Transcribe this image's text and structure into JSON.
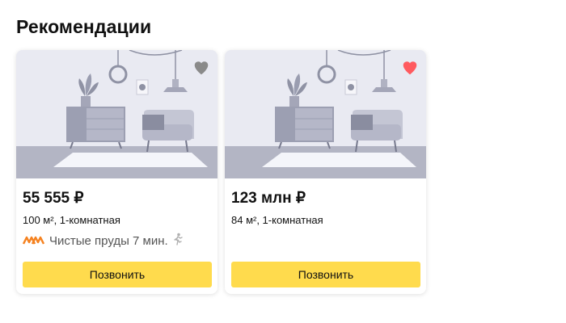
{
  "section": {
    "title": "Рекомендации"
  },
  "colors": {
    "accent_button": "#ffdb4d",
    "favorite_active": "#ff5a5f",
    "favorite_inactive": "#8a8a8a",
    "metro_line": "#f58220"
  },
  "cards": [
    {
      "price": "55 555 ₽",
      "details": "100 м², 1-комнатная",
      "metro_station": "Чистые пруды 7 мин.",
      "favorite": false,
      "icons": [
        "heart-icon",
        "metro-icon",
        "walk-icon"
      ],
      "call_label": "Позвонить"
    },
    {
      "price": "123 млн ₽",
      "details": "84 м², 1-комнатная",
      "favorite": true,
      "icons": [
        "heart-icon"
      ],
      "call_label": "Позвонить"
    }
  ]
}
